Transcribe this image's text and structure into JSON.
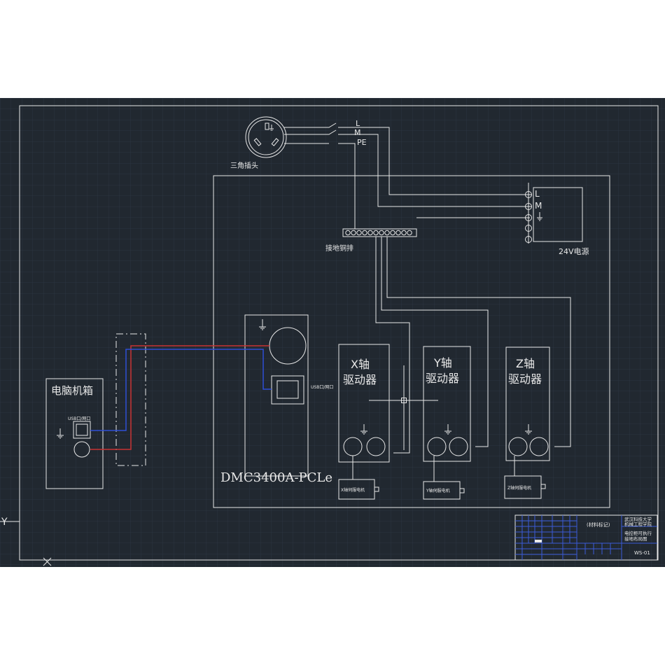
{
  "colors": {
    "background": "#212830",
    "grid": "#2c3541",
    "line": "#e8e8e8",
    "titleblock_line": "#3a5bd9",
    "wire_red": "#c83232",
    "wire_blue": "#2f4fd6"
  },
  "labels": {
    "plug": "三角插头",
    "line_L": "L",
    "line_M": "M",
    "line_PE": "PE",
    "ground_bar": "接地铜排",
    "psu_title": "24V电源",
    "psu_L": "L",
    "psu_M": "M",
    "computer": "电脑机箱",
    "computer_usb": "USB口/网口",
    "controller_usb": "USB口/网口",
    "controller": "DMC3400A-PCLe",
    "x_driver_line1": "X轴",
    "x_driver_line2": "驱动器",
    "y_driver_line1": "Y轴",
    "y_driver_line2": "驱动器",
    "z_driver_line1": "Z轴",
    "z_driver_line2": "驱动器",
    "x_motor": "X轴伺服电机",
    "y_motor": "Y轴伺服电机",
    "z_motor": "Z轴伺服电机",
    "axis_y": "Y",
    "axis_x": "X"
  },
  "title_block": {
    "material": "(材料标记)",
    "org_line1": "武汉科技大学",
    "org_line2": "机械工程学院",
    "drawing_line1": "电控柜可执行",
    "drawing_line2": "接地布局图",
    "drawing_no": "WS-01"
  }
}
